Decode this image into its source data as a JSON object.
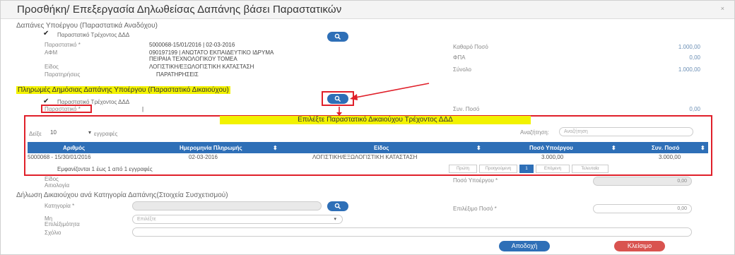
{
  "modal": {
    "title": "Προσθήκη/ Επεξεργασία Δηλωθείσας Δαπάνης βάσει Παραστατικών",
    "close": "×"
  },
  "expenses_section": {
    "title": "Δαπάνες Υποέργου (Παραστατικά Αναδόχου)",
    "current_checkbox_label": "Παραστατικό Τρέχοντος ΔΔΔ",
    "invoice_label": "Παραστατικό *",
    "invoice_value": "5000068-15/01/2016 | 02-03-2016",
    "afm_label": "ΑΦΜ",
    "afm_value_line1": "090197199 | ΑΝΩΤΑΤΟ ΕΚΠΑΙΔΕΥΤΙΚΟ ΙΔΡΥΜΑ",
    "afm_value_line2": "ΠΕΙΡΑΙΑ ΤΕΧΝΟΛΟΓΙΚΟΥ ΤΟΜΕΑ",
    "type_label": "Είδος",
    "type_value": "ΛΟΓΙΣΤΙΚΗ/ΕΞΩΛΟΓΙΣΤΙΚΗ ΚΑΤΑΣΤΑΣΗ",
    "notes_label": "Παρατηρήσεις",
    "notes_value": "ΠΑΡΑΤΗΡΗΣΕΙΣ",
    "net_label": "Καθαρό Ποσό",
    "net_value": "1.000,00",
    "vat_label": "ΦΠΑ",
    "vat_value": "0,00",
    "total_label": "Σύνολο",
    "total_value": "1.000,00"
  },
  "payments_section": {
    "title": "Πληρωμές Δημόσιας Δαπάνης Υποέργου (Παραστατικό Δικαιούχου)",
    "current_checkbox_label": "Παραστατικό Τρέχοντος ΔΔΔ",
    "invoice_label": "Παραστατικό *",
    "invoice_value": "|",
    "sum_label": "Συν. Ποσό",
    "sum_value": "0,00"
  },
  "picker": {
    "title": "Επιλέξτε Παραστατικό Δικαιούχου Τρέχοντος ΔΔΔ",
    "show_label": "Δείξε",
    "page_size": "10",
    "records_label": "εγγραφές",
    "search_label": "Αναζήτηση:",
    "search_placeholder": "Αναζήτηση",
    "columns": [
      "Αριθμός",
      "Ημερομηνία Πληρωμής",
      "Είδος",
      "Ποσό Υποέργου",
      "Συν. Ποσό"
    ],
    "rows": [
      [
        "5000068 - 15/30/01/2016",
        "02-03-2016",
        "ΛΟΓΙΣΤΙΚΗ/ΕΞΩΛΟΓΙΣΤΙΚΗ ΚΑΤΑΣΤΑΣΗ",
        "3.000,00",
        "3.000,00"
      ]
    ],
    "info": "Εμφανίζονται 1 έως 1 από 1 εγγραφές",
    "pagination": {
      "first": "Πρώτη",
      "prev": "Προηγούμενη",
      "current": "1",
      "next": "Επόμενη",
      "last": "Τελευταία"
    }
  },
  "below_picker": {
    "type_label": "Είδος",
    "justification_label": "Αιτιολογία",
    "project_amount_label": "Ποσό Υποέργου *",
    "project_amount_value": "0,00"
  },
  "declaration_section": {
    "title": "Δήλωση Δικαιούχου ανά Κατηγορία Δαπάνης(Στοιχεία Συσχετισμού)",
    "category_label": "Κατηγορία *",
    "selected_amount_label": "Επιλέξιμο Ποσό *",
    "selected_amount_value": "0,00",
    "non_eligible_label_line1": "Μη",
    "non_eligible_label_line2": "Επιλέξιμότητα",
    "non_eligible_placeholder": "Επιλέξτε",
    "comment_label": "Σχόλιο"
  },
  "footer": {
    "accept": "Αποδοχή",
    "close": "Κλείσιμο"
  },
  "colors": {
    "primary": "#2e6fb7",
    "danger": "#d9534f",
    "annotation_red": "#e0202a",
    "highlight_yellow": "#f2f200"
  }
}
